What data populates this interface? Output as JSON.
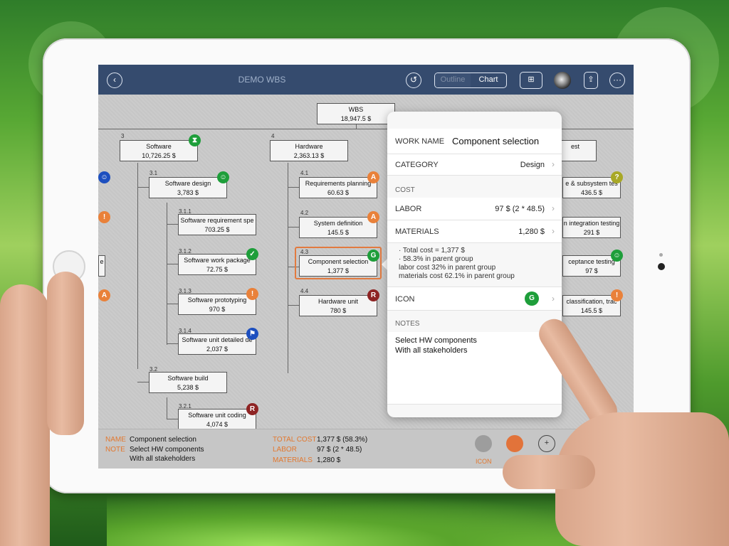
{
  "toolbar": {
    "back_icon": "back-arrow-icon",
    "title": "DEMO WBS",
    "undo_icon": "undo-icon",
    "tabs": [
      {
        "label": "Outline",
        "active": false
      },
      {
        "label": "Chart",
        "active": true
      }
    ]
  },
  "nodes": {
    "wbs": {
      "name": "WBS",
      "value": "18,947.5 $"
    },
    "software": {
      "id": "3",
      "name": "Software",
      "value": "10,726.25 $"
    },
    "hardware": {
      "id": "4",
      "name": "Hardware",
      "value": "2,363.13 $"
    },
    "test": {
      "name": "est"
    },
    "software_design": {
      "id": "3.1",
      "name": "Software design",
      "value": "3,783 $"
    },
    "sw_req": {
      "id": "3.1.1",
      "name": "Software requirement spe",
      "value": "703.25 $"
    },
    "sw_work": {
      "id": "3.1.2",
      "name": "Software work package",
      "value": "72.75 $"
    },
    "sw_proto": {
      "id": "3.1.3",
      "name": "Software prototyping",
      "value": "970 $"
    },
    "sw_detail": {
      "id": "3.1.4",
      "name": "Software unit detailed de",
      "value": "2,037 $"
    },
    "sw_build": {
      "id": "3.2",
      "name": "Software build",
      "value": "5,238 $"
    },
    "sw_coding": {
      "id": "3.2.1",
      "name": "Software unit coding",
      "value": "4,074 $"
    },
    "req_planning": {
      "id": "4.1",
      "name": "Requirements planning",
      "value": "60.63 $"
    },
    "sys_def": {
      "id": "4.2",
      "name": "System definition",
      "value": "145.5 $"
    },
    "comp_sel": {
      "id": "4.3",
      "name": "Component selection",
      "value": "1,377 $"
    },
    "hw_unit": {
      "id": "4.4",
      "name": "Hardware unit",
      "value": "780 $"
    },
    "subsystem_test": {
      "name": "e & subsystem tes",
      "value": "436.5 $"
    },
    "integration_test": {
      "name": "n integration testing",
      "value": "291 $"
    },
    "acceptance_test": {
      "name": "ceptance testing",
      "value": "97 $"
    },
    "classification": {
      "name": "classification, trac",
      "value": "145.5 $"
    },
    "left_e": {
      "name": "e"
    }
  },
  "badges": {
    "A": "A",
    "G": "G",
    "R": "R",
    "Q": "?",
    "EXCL": "!"
  },
  "colors": {
    "orange": "#e9813a",
    "green": "#1e9e3a",
    "red": "#8e2323",
    "blue": "#1d4fbf",
    "olive": "#a8a826",
    "toolbar": "#354b6e"
  },
  "popover": {
    "work_name_label": "WORK NAME",
    "work_name_value": "Component selection",
    "category_label": "CATEGORY",
    "category_value": "Design",
    "cost_section": "COST",
    "labor_label": "LABOR",
    "labor_value": "97 $ (2 * 48.5)",
    "materials_label": "MATERIALS",
    "materials_value": "1,280 $",
    "cost_notes": [
      "· Total cost = 1,377 $",
      "· 58.3% in parent group",
      "labor cost 32% in parent group",
      "materials cost 62.1% in parent group"
    ],
    "icon_label": "ICON",
    "icon_value": "G",
    "notes_section": "NOTES",
    "notes": [
      "Select HW components",
      "With all stakeholders"
    ]
  },
  "footer": {
    "name_label": "NAME",
    "name_value": "Component selection",
    "note_label": "NOTE",
    "note_lines": [
      "Select HW components",
      "With all stakeholders"
    ],
    "total_cost_label": "TOTAL COST",
    "total_cost_value": "1,377 $ (58.3%)",
    "labor_label": "LABOR",
    "labor_value": "97 $  (2 * 48.5)",
    "materials_label": "MATERIALS",
    "materials_value": "1,280 $",
    "icon_label": "ICON"
  }
}
